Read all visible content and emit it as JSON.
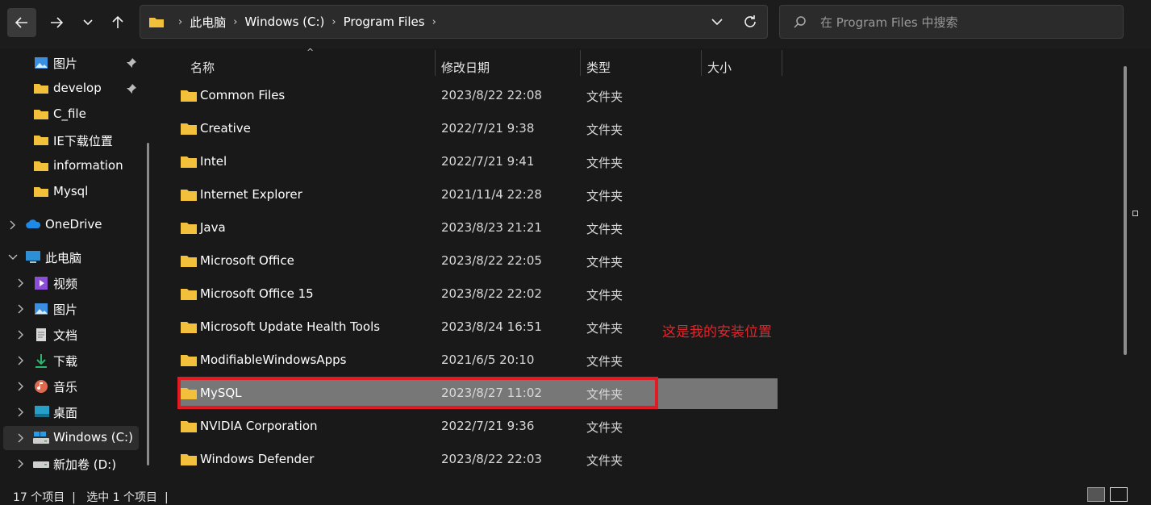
{
  "nav_buttons": {
    "back": "back-arrow",
    "forward": "forward-arrow",
    "recent": "chevron-down",
    "up": "up-arrow"
  },
  "address": {
    "crumbs": [
      "此电脑",
      "Windows (C:)",
      "Program Files"
    ]
  },
  "search": {
    "placeholder": "在 Program Files 中搜索"
  },
  "sidebar": {
    "quick_access": [
      {
        "label": "图片",
        "icon": "pictures-icon",
        "pinned": true
      },
      {
        "label": "develop",
        "icon": "folder-icon",
        "pinned": true
      },
      {
        "label": "C_file",
        "icon": "folder-icon",
        "pinned": false
      },
      {
        "label": "IE下载位置",
        "icon": "folder-icon",
        "pinned": false
      },
      {
        "label": "information",
        "icon": "folder-icon",
        "pinned": false
      },
      {
        "label": "Mysql",
        "icon": "folder-icon",
        "pinned": false
      }
    ],
    "onedrive": "OneDrive",
    "this_pc": "此电脑",
    "pc_items": [
      {
        "label": "视频",
        "icon": "videos-icon"
      },
      {
        "label": "图片",
        "icon": "pictures-icon"
      },
      {
        "label": "文档",
        "icon": "documents-icon"
      },
      {
        "label": "下载",
        "icon": "downloads-icon"
      },
      {
        "label": "音乐",
        "icon": "music-icon"
      },
      {
        "label": "桌面",
        "icon": "desktop-icon"
      },
      {
        "label": "Windows (C:)",
        "icon": "drive-c-icon",
        "selected": true
      },
      {
        "label": "新加卷 (D:)",
        "icon": "drive-icon"
      }
    ]
  },
  "columns": {
    "name": "名称",
    "date": "修改日期",
    "type": "类型",
    "size": "大小"
  },
  "files": [
    {
      "name": "Common Files",
      "date": "2023/8/22 22:08",
      "type": "文件夹"
    },
    {
      "name": "Creative",
      "date": "2022/7/21 9:38",
      "type": "文件夹"
    },
    {
      "name": "Intel",
      "date": "2022/7/21 9:41",
      "type": "文件夹"
    },
    {
      "name": "Internet Explorer",
      "date": "2021/11/4 22:28",
      "type": "文件夹"
    },
    {
      "name": "Java",
      "date": "2023/8/23 21:21",
      "type": "文件夹"
    },
    {
      "name": "Microsoft Office",
      "date": "2023/8/22 22:05",
      "type": "文件夹"
    },
    {
      "name": "Microsoft Office 15",
      "date": "2023/8/22 22:02",
      "type": "文件夹"
    },
    {
      "name": "Microsoft Update Health Tools",
      "date": "2023/8/24 16:51",
      "type": "文件夹"
    },
    {
      "name": "ModifiableWindowsApps",
      "date": "2021/6/5 20:10",
      "type": "文件夹"
    },
    {
      "name": "MySQL",
      "date": "2023/8/27 11:02",
      "type": "文件夹",
      "selected": true
    },
    {
      "name": "NVIDIA Corporation",
      "date": "2022/7/21 9:36",
      "type": "文件夹"
    },
    {
      "name": "Windows Defender",
      "date": "2023/8/22 22:03",
      "type": "文件夹"
    }
  ],
  "annotation": {
    "text": "这是我的安装位置",
    "color": "#e0262d"
  },
  "status": {
    "count": "17 个项目",
    "selected": "选中 1 个项目"
  },
  "colors": {
    "folder": "#f3c03c",
    "selection": "#777777",
    "highlight_border": "#e01b24"
  }
}
